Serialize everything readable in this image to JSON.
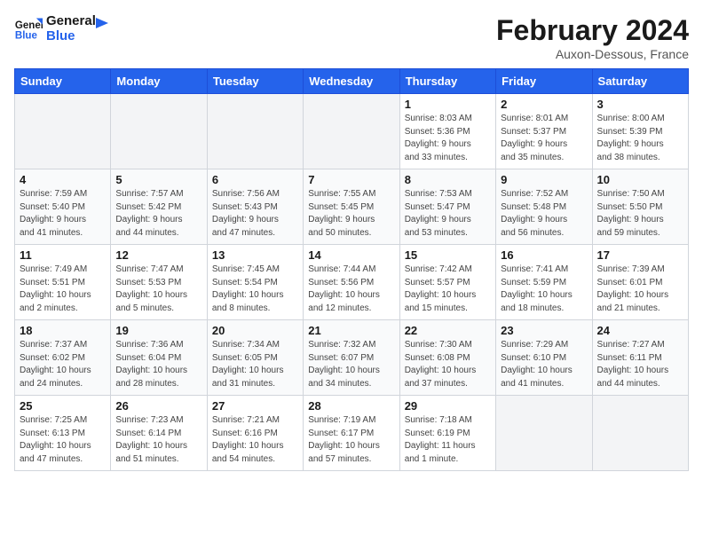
{
  "logo": {
    "line1": "General",
    "line2": "Blue"
  },
  "title": "February 2024",
  "subtitle": "Auxon-Dessous, France",
  "days_of_week": [
    "Sunday",
    "Monday",
    "Tuesday",
    "Wednesday",
    "Thursday",
    "Friday",
    "Saturday"
  ],
  "weeks": [
    [
      {
        "day": "",
        "info": ""
      },
      {
        "day": "",
        "info": ""
      },
      {
        "day": "",
        "info": ""
      },
      {
        "day": "",
        "info": ""
      },
      {
        "day": "1",
        "info": "Sunrise: 8:03 AM\nSunset: 5:36 PM\nDaylight: 9 hours\nand 33 minutes."
      },
      {
        "day": "2",
        "info": "Sunrise: 8:01 AM\nSunset: 5:37 PM\nDaylight: 9 hours\nand 35 minutes."
      },
      {
        "day": "3",
        "info": "Sunrise: 8:00 AM\nSunset: 5:39 PM\nDaylight: 9 hours\nand 38 minutes."
      }
    ],
    [
      {
        "day": "4",
        "info": "Sunrise: 7:59 AM\nSunset: 5:40 PM\nDaylight: 9 hours\nand 41 minutes."
      },
      {
        "day": "5",
        "info": "Sunrise: 7:57 AM\nSunset: 5:42 PM\nDaylight: 9 hours\nand 44 minutes."
      },
      {
        "day": "6",
        "info": "Sunrise: 7:56 AM\nSunset: 5:43 PM\nDaylight: 9 hours\nand 47 minutes."
      },
      {
        "day": "7",
        "info": "Sunrise: 7:55 AM\nSunset: 5:45 PM\nDaylight: 9 hours\nand 50 minutes."
      },
      {
        "day": "8",
        "info": "Sunrise: 7:53 AM\nSunset: 5:47 PM\nDaylight: 9 hours\nand 53 minutes."
      },
      {
        "day": "9",
        "info": "Sunrise: 7:52 AM\nSunset: 5:48 PM\nDaylight: 9 hours\nand 56 minutes."
      },
      {
        "day": "10",
        "info": "Sunrise: 7:50 AM\nSunset: 5:50 PM\nDaylight: 9 hours\nand 59 minutes."
      }
    ],
    [
      {
        "day": "11",
        "info": "Sunrise: 7:49 AM\nSunset: 5:51 PM\nDaylight: 10 hours\nand 2 minutes."
      },
      {
        "day": "12",
        "info": "Sunrise: 7:47 AM\nSunset: 5:53 PM\nDaylight: 10 hours\nand 5 minutes."
      },
      {
        "day": "13",
        "info": "Sunrise: 7:45 AM\nSunset: 5:54 PM\nDaylight: 10 hours\nand 8 minutes."
      },
      {
        "day": "14",
        "info": "Sunrise: 7:44 AM\nSunset: 5:56 PM\nDaylight: 10 hours\nand 12 minutes."
      },
      {
        "day": "15",
        "info": "Sunrise: 7:42 AM\nSunset: 5:57 PM\nDaylight: 10 hours\nand 15 minutes."
      },
      {
        "day": "16",
        "info": "Sunrise: 7:41 AM\nSunset: 5:59 PM\nDaylight: 10 hours\nand 18 minutes."
      },
      {
        "day": "17",
        "info": "Sunrise: 7:39 AM\nSunset: 6:01 PM\nDaylight: 10 hours\nand 21 minutes."
      }
    ],
    [
      {
        "day": "18",
        "info": "Sunrise: 7:37 AM\nSunset: 6:02 PM\nDaylight: 10 hours\nand 24 minutes."
      },
      {
        "day": "19",
        "info": "Sunrise: 7:36 AM\nSunset: 6:04 PM\nDaylight: 10 hours\nand 28 minutes."
      },
      {
        "day": "20",
        "info": "Sunrise: 7:34 AM\nSunset: 6:05 PM\nDaylight: 10 hours\nand 31 minutes."
      },
      {
        "day": "21",
        "info": "Sunrise: 7:32 AM\nSunset: 6:07 PM\nDaylight: 10 hours\nand 34 minutes."
      },
      {
        "day": "22",
        "info": "Sunrise: 7:30 AM\nSunset: 6:08 PM\nDaylight: 10 hours\nand 37 minutes."
      },
      {
        "day": "23",
        "info": "Sunrise: 7:29 AM\nSunset: 6:10 PM\nDaylight: 10 hours\nand 41 minutes."
      },
      {
        "day": "24",
        "info": "Sunrise: 7:27 AM\nSunset: 6:11 PM\nDaylight: 10 hours\nand 44 minutes."
      }
    ],
    [
      {
        "day": "25",
        "info": "Sunrise: 7:25 AM\nSunset: 6:13 PM\nDaylight: 10 hours\nand 47 minutes."
      },
      {
        "day": "26",
        "info": "Sunrise: 7:23 AM\nSunset: 6:14 PM\nDaylight: 10 hours\nand 51 minutes."
      },
      {
        "day": "27",
        "info": "Sunrise: 7:21 AM\nSunset: 6:16 PM\nDaylight: 10 hours\nand 54 minutes."
      },
      {
        "day": "28",
        "info": "Sunrise: 7:19 AM\nSunset: 6:17 PM\nDaylight: 10 hours\nand 57 minutes."
      },
      {
        "day": "29",
        "info": "Sunrise: 7:18 AM\nSunset: 6:19 PM\nDaylight: 11 hours\nand 1 minute."
      },
      {
        "day": "",
        "info": ""
      },
      {
        "day": "",
        "info": ""
      }
    ]
  ]
}
